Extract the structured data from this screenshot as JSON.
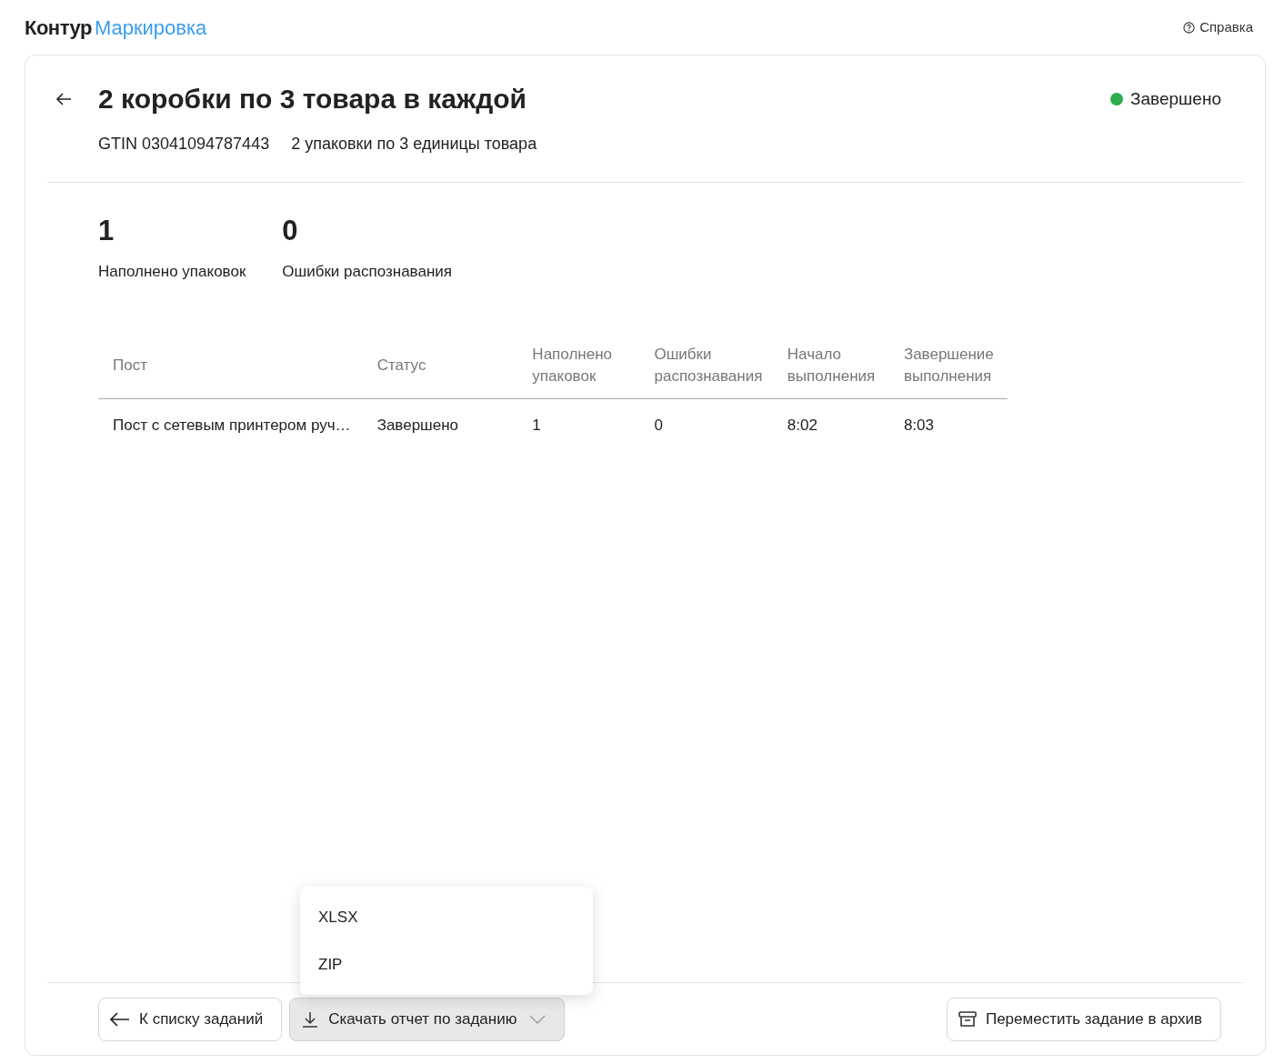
{
  "header": {
    "logo_brand": "Контур",
    "logo_product": "Маркировка",
    "help_link": "Справка"
  },
  "task": {
    "title": "2 коробки по 3 товара в каждой",
    "status": "Завершено",
    "gtin": "GTIN 03041094787443",
    "packaging": "2 упаковки по 3 единицы товара"
  },
  "stats": [
    {
      "value": "1",
      "label": "Наполнено упаковок"
    },
    {
      "value": "0",
      "label": "Ошибки распознавания"
    }
  ],
  "table": {
    "columns": [
      "Пост",
      "Статус",
      "Наполнено упаковок",
      "Ошибки распознавания",
      "Начало выполнения",
      "Завершение выполнения"
    ],
    "rows": [
      [
        "Пост с сетевым принтером руч…",
        "Завершено",
        "1",
        "0",
        "8:02",
        "8:03"
      ]
    ]
  },
  "footer": {
    "back_button": "К списку заданий",
    "download_button": {
      "label": "Скачать отчет по заданию",
      "expanded": true,
      "options": [
        "XLSX",
        "ZIP"
      ]
    },
    "archive_button": "Переместить задание в архив"
  }
}
